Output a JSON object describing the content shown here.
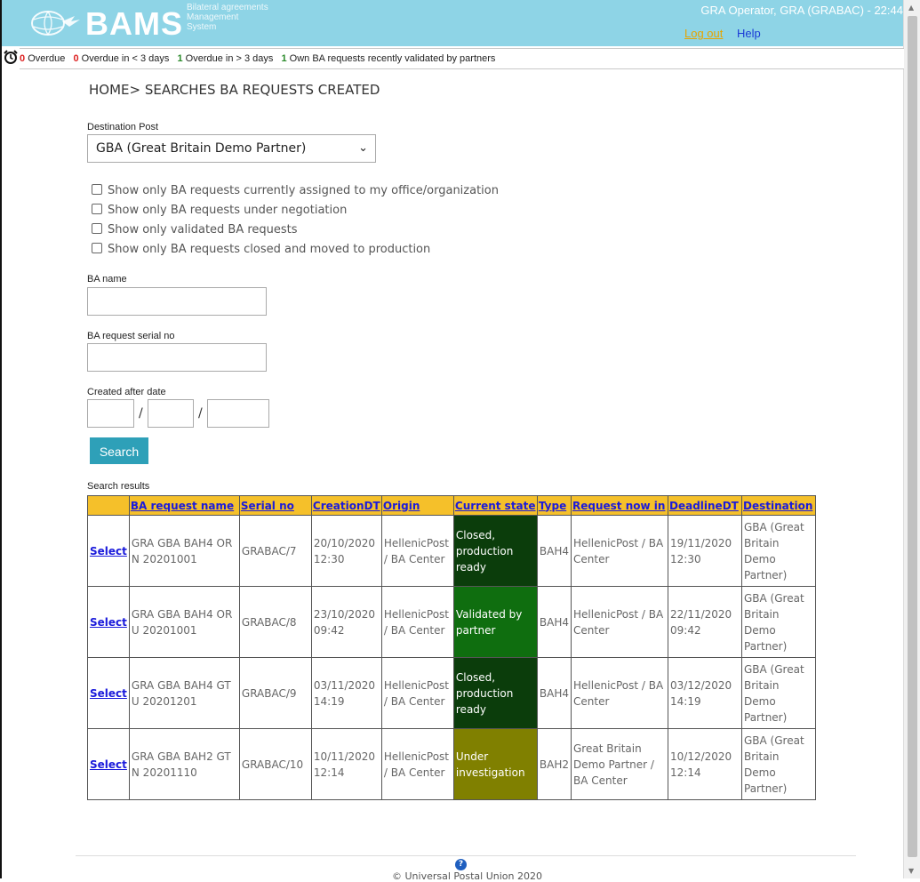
{
  "header": {
    "logo": "BAMS",
    "subtitle_lines": [
      "Bilateral agreements",
      "Management",
      "System"
    ],
    "user": "GRA Operator, GRA (GRABAC) - 22:44",
    "logout": "Log out",
    "help": "Help"
  },
  "alerts": [
    {
      "count": "0",
      "label": "Overdue",
      "color": "#dd2222"
    },
    {
      "count": "0",
      "label": "Overdue in < 3 days",
      "color": "#dd2222"
    },
    {
      "count": "1",
      "label": "Overdue in > 3 days",
      "color": "#2a8a2a"
    },
    {
      "count": "1",
      "label": "Own BA requests recently validated by partners",
      "color": "#2a8a2a"
    }
  ],
  "breadcrumb": "HOME> SEARCHES BA REQUESTS CREATED",
  "form": {
    "destination_label": "Destination Post",
    "destination_value": "GBA (Great Britain Demo Partner)",
    "checkboxes": [
      "Show only BA requests currently assigned to my office/organization",
      "Show only BA requests under negotiation",
      "Show only validated BA requests",
      "Show only BA requests closed and moved to production"
    ],
    "ba_name_label": "BA name",
    "serial_label": "BA request serial no",
    "date_label": "Created after date",
    "search_button": "Search",
    "results_label": "Search results"
  },
  "table": {
    "headers": [
      "BA request name",
      "Serial no",
      "CreationDT",
      "Origin",
      "Current state",
      "Type",
      "Request now in",
      "DeadlineDT",
      "Destination"
    ],
    "select_label": "Select",
    "rows": [
      {
        "name": "GRA GBA BAH4 OR N 20201001",
        "serial": "GRABAC/7",
        "created": "20/10/2020 12:30",
        "origin": "HellenicPost / BA Center",
        "state": "Closed, production ready",
        "state_class": "st-closed",
        "type": "BAH4",
        "now_in": "HellenicPost / BA Center",
        "deadline": "19/11/2020 12:30",
        "destination": "GBA (Great Britain Demo Partner)"
      },
      {
        "name": "GRA GBA BAH4 OR U 20201001",
        "serial": "GRABAC/8",
        "created": "23/10/2020 09:42",
        "origin": "HellenicPost / BA Center",
        "state": "Validated by partner",
        "state_class": "st-valid",
        "type": "BAH4",
        "now_in": "HellenicPost / BA Center",
        "deadline": "22/11/2020 09:42",
        "destination": "GBA (Great Britain Demo Partner)"
      },
      {
        "name": "GRA GBA BAH4 GT U 20201201",
        "serial": "GRABAC/9",
        "created": "03/11/2020 14:19",
        "origin": "HellenicPost / BA Center",
        "state": "Closed, production ready",
        "state_class": "st-closed",
        "type": "BAH4",
        "now_in": "HellenicPost / BA Center",
        "deadline": "03/12/2020 14:19",
        "destination": "GBA (Great Britain Demo Partner)"
      },
      {
        "name": "GRA GBA BAH2 GT N 20201110",
        "serial": "GRABAC/10",
        "created": "10/11/2020 12:14",
        "origin": "HellenicPost / BA Center",
        "state": "Under investigation",
        "state_class": "st-invest",
        "type": "BAH2",
        "now_in": "Great Britain Demo Partner / BA Center",
        "deadline": "10/12/2020 12:14",
        "destination": "GBA (Great Britain Demo Partner)"
      }
    ]
  },
  "footer": "© Universal Postal Union 2020"
}
